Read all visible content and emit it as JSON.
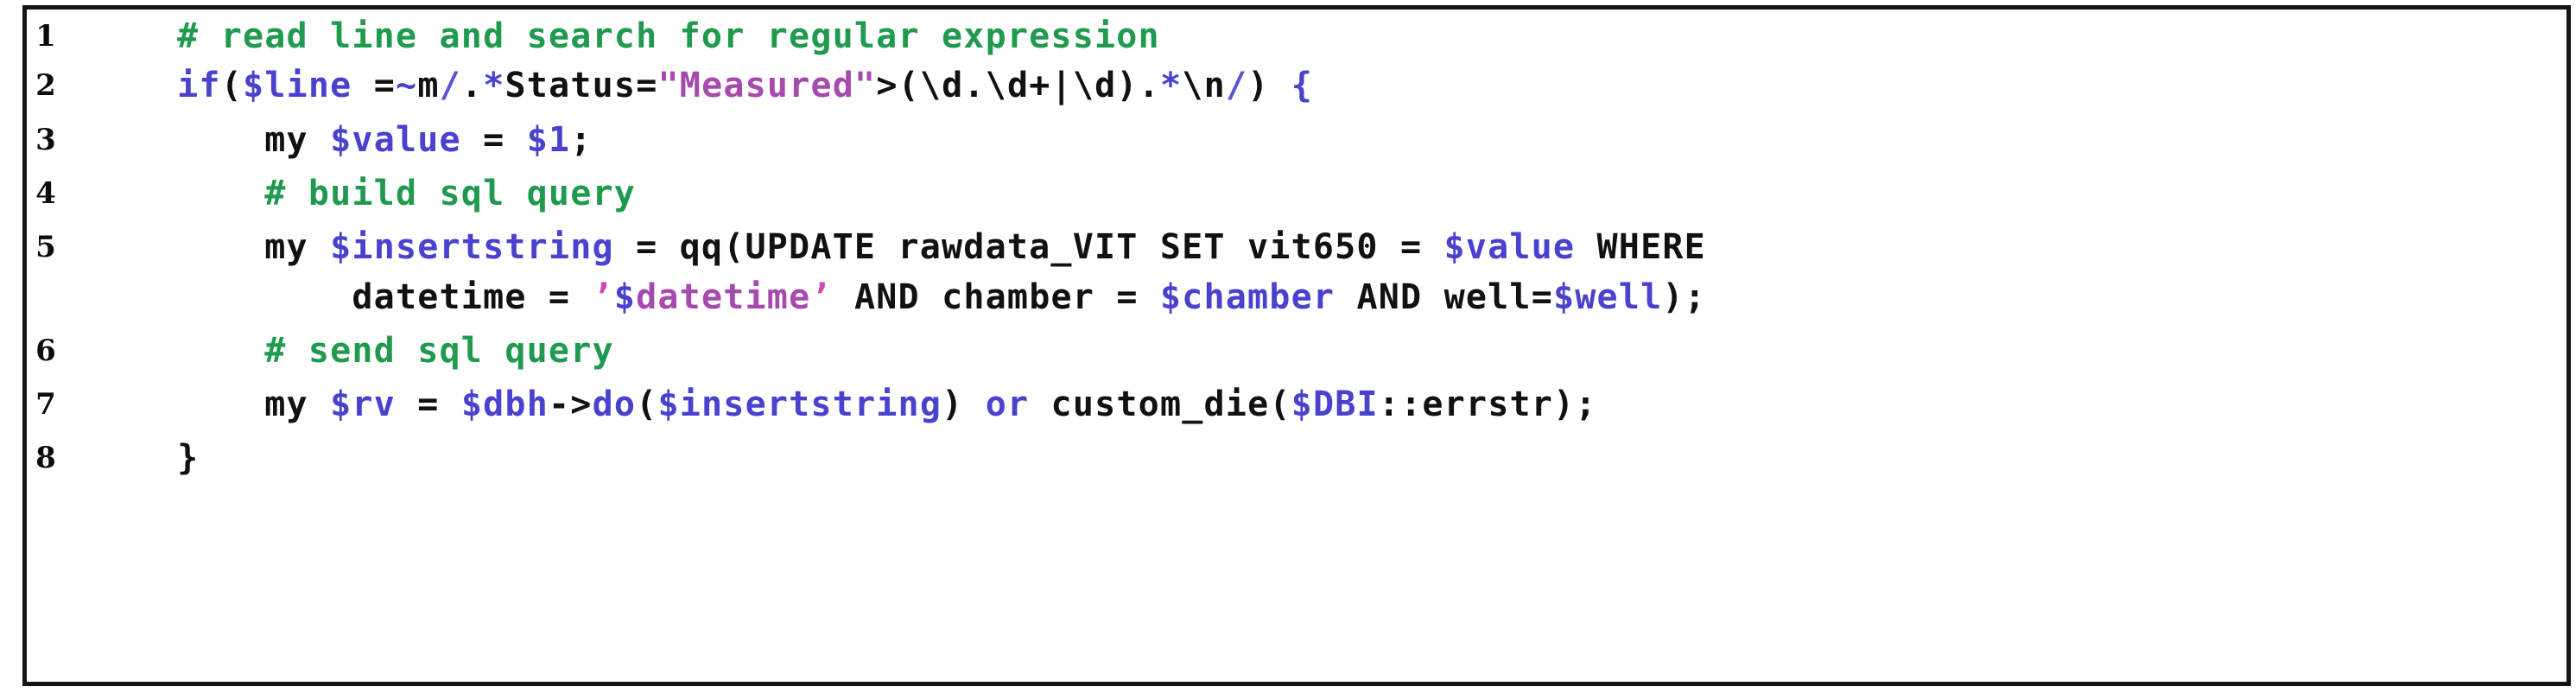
{
  "figure": {
    "kind": "code-listing",
    "language": "Perl",
    "border_color": "#141414",
    "background": "#ffffff",
    "colors": {
      "comment": "#1f9a4e",
      "keyword": "#4a42cf",
      "variable": "#4a42cf",
      "string": "#a64ab0",
      "quote": "#cf46b8",
      "plain": "#111111"
    }
  },
  "listing": {
    "line_numbers": [
      "1",
      "2",
      "3",
      "4",
      "5",
      "",
      "6",
      "7",
      "8"
    ],
    "lines": [
      {
        "number": "1",
        "indent": "    ",
        "text": "# read line and search for regular expression",
        "tokens": [
          {
            "t": "    ",
            "c": "plain"
          },
          {
            "t": "# read line and search for regular expression",
            "c": "comment"
          }
        ]
      },
      {
        "number": "2",
        "indent": "    ",
        "text": "if($line =~m/.*Status=\"Measured\">(\\d.\\d+|\\d).*\\n/) {",
        "tokens": [
          {
            "t": "    ",
            "c": "plain"
          },
          {
            "t": "if",
            "c": "keyword"
          },
          {
            "t": "(",
            "c": "plain"
          },
          {
            "t": "$",
            "c": "variable"
          },
          {
            "t": "line",
            "c": "variable"
          },
          {
            "t": " =",
            "c": "plain"
          },
          {
            "t": "~",
            "c": "keyword"
          },
          {
            "t": "m",
            "c": "plain"
          },
          {
            "t": "/",
            "c": "regexdelim"
          },
          {
            "t": ".",
            "c": "plain"
          },
          {
            "t": "*",
            "c": "keyword"
          },
          {
            "t": "Status=",
            "c": "plain"
          },
          {
            "t": "\"Measured\"",
            "c": "string"
          },
          {
            "t": ">(\\d.\\d+|\\d).",
            "c": "plain"
          },
          {
            "t": "*",
            "c": "keyword"
          },
          {
            "t": "\\n",
            "c": "plain"
          },
          {
            "t": "/",
            "c": "regexdelim"
          },
          {
            "t": ") ",
            "c": "plain"
          },
          {
            "t": "{",
            "c": "keyword"
          }
        ]
      },
      {
        "number": "3",
        "indent": "        ",
        "text": "my $value = $1;",
        "tokens": [
          {
            "t": "        ",
            "c": "plain"
          },
          {
            "t": "my ",
            "c": "plain"
          },
          {
            "t": "$value",
            "c": "variable"
          },
          {
            "t": " = ",
            "c": "plain"
          },
          {
            "t": "$1",
            "c": "variable"
          },
          {
            "t": ";",
            "c": "plain"
          }
        ]
      },
      {
        "number": "4",
        "indent": "        ",
        "text": "# build sql query",
        "tokens": [
          {
            "t": "        ",
            "c": "plain"
          },
          {
            "t": "# build sql query",
            "c": "comment"
          }
        ]
      },
      {
        "number": "5",
        "indent": "        ",
        "text": "my $insertstring = qq(UPDATE rawdata_VIT SET vit650 = $value WHERE",
        "tokens": [
          {
            "t": "        ",
            "c": "plain"
          },
          {
            "t": "my ",
            "c": "plain"
          },
          {
            "t": "$insertstring",
            "c": "variable"
          },
          {
            "t": " = qq(UPDATE rawdata_VIT SET vit650 = ",
            "c": "plain"
          },
          {
            "t": "$value",
            "c": "variable"
          },
          {
            "t": " WHERE",
            "c": "plain"
          }
        ]
      },
      {
        "number": "",
        "continuation": true,
        "indent": "            ",
        "text": "datetime = '$datetime' AND chamber = $chamber AND well=$well);",
        "tokens": [
          {
            "t": "            ",
            "c": "plain"
          },
          {
            "t": "datetime = ",
            "c": "plain"
          },
          {
            "t": "’",
            "c": "quote"
          },
          {
            "t": "$",
            "c": "variable"
          },
          {
            "t": "datetime",
            "c": "string"
          },
          {
            "t": "’",
            "c": "quote"
          },
          {
            "t": " AND chamber = ",
            "c": "plain"
          },
          {
            "t": "$chamber",
            "c": "variable"
          },
          {
            "t": " AND well=",
            "c": "plain"
          },
          {
            "t": "$well",
            "c": "variable"
          },
          {
            "t": ");",
            "c": "plain"
          }
        ]
      },
      {
        "number": "6",
        "indent": "        ",
        "text": "# send sql query",
        "tokens": [
          {
            "t": "        ",
            "c": "plain"
          },
          {
            "t": "# send sql query",
            "c": "comment"
          }
        ]
      },
      {
        "number": "7",
        "indent": "        ",
        "text": "my $rv = $dbh->do($insertstring) or custom_die($DBI::errstr);",
        "tokens": [
          {
            "t": "        ",
            "c": "plain"
          },
          {
            "t": "my ",
            "c": "plain"
          },
          {
            "t": "$rv",
            "c": "variable"
          },
          {
            "t": " = ",
            "c": "plain"
          },
          {
            "t": "$dbh",
            "c": "variable"
          },
          {
            "t": "->",
            "c": "plain"
          },
          {
            "t": "do",
            "c": "keyword"
          },
          {
            "t": "(",
            "c": "plain"
          },
          {
            "t": "$insertstring",
            "c": "variable"
          },
          {
            "t": ") ",
            "c": "plain"
          },
          {
            "t": "or",
            "c": "keyword"
          },
          {
            "t": " custom_die(",
            "c": "plain"
          },
          {
            "t": "$DBI",
            "c": "variable"
          },
          {
            "t": "::errstr);",
            "c": "plain"
          }
        ]
      },
      {
        "number": "8",
        "indent": "    ",
        "text": "}",
        "tokens": [
          {
            "t": "    ",
            "c": "plain"
          },
          {
            "t": "}",
            "c": "plain"
          }
        ]
      }
    ]
  }
}
